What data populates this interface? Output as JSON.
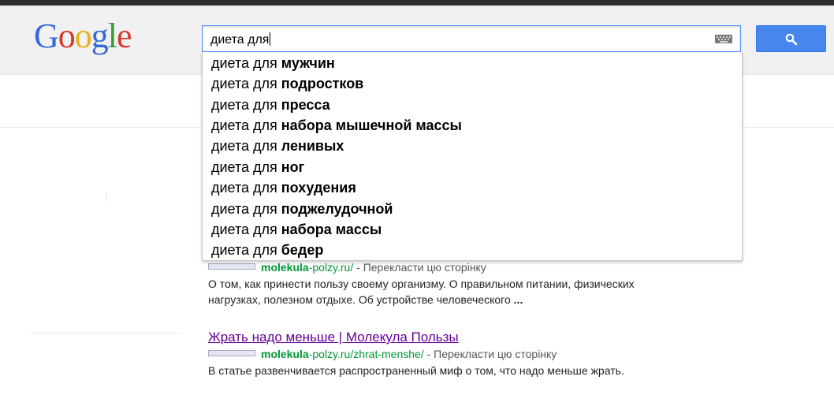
{
  "logo": {
    "letters": [
      "G",
      "o",
      "o",
      "g",
      "l",
      "e"
    ]
  },
  "search": {
    "query": "диета для",
    "suggestions": [
      {
        "prefix": "диета для ",
        "completion": "мужчин"
      },
      {
        "prefix": "диета для ",
        "completion": "подростков"
      },
      {
        "prefix": "диета для ",
        "completion": "пресса"
      },
      {
        "prefix": "диета для ",
        "completion": "набора мышечной массы"
      },
      {
        "prefix": "диета для ",
        "completion": "ленивых"
      },
      {
        "prefix": "диета для ",
        "completion": "ног"
      },
      {
        "prefix": "диета для ",
        "completion": "похудения"
      },
      {
        "prefix": "диета для ",
        "completion": "поджелудочной"
      },
      {
        "prefix": "диета для ",
        "completion": "набора массы"
      },
      {
        "prefix": "диета для ",
        "completion": "бедер"
      }
    ]
  },
  "results": [
    {
      "url_bold": "molekula",
      "url_rest": "-polzy.ru/",
      "sep": " - ",
      "translate": "Перекласти цю сторінку",
      "snippet_line1": "О том, как принести пользу своему организму. О правильном питании, физических",
      "snippet_line2": "нагрузках, полезном отдыхе. Об устройстве человеческого ",
      "snippet_ellipsis": "..."
    },
    {
      "title": "Жрать надо меньше | Молекула Пользы",
      "url_bold": "molekula",
      "url_rest": "-polzy.ru/zhrat-menshe/",
      "sep": " - ",
      "translate": "Перекласти цю сторінку",
      "snippet_line1": "В статье развенчивается распространенный миф о том, что надо меньше жрать."
    }
  ],
  "colors": {
    "logo_blue": "#3669d6",
    "logo_red": "#d8382c",
    "logo_yellow": "#e8b219",
    "logo_green": "#3a9a3a",
    "search_button": "#4787ed",
    "focus_border": "#4d90fe",
    "url_green": "#009933",
    "visited_title": "#660099"
  },
  "icons": {
    "keyboard": "keyboard-icon",
    "search": "magnifier-icon"
  }
}
